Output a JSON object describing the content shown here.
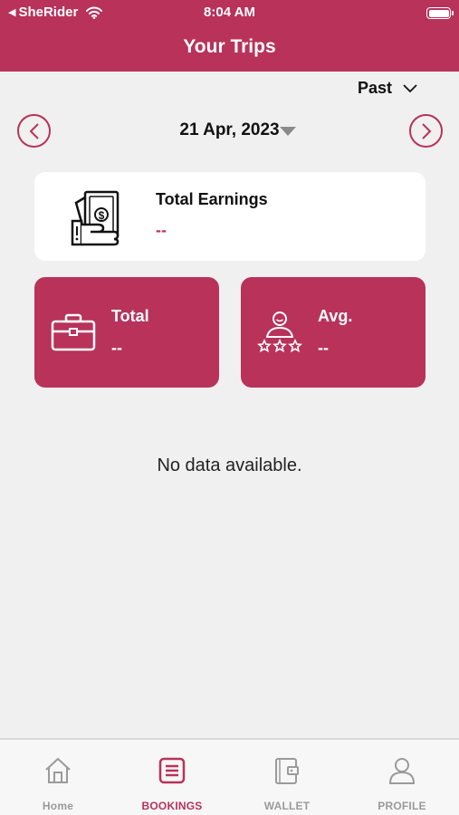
{
  "status_bar": {
    "back_app": "SheRider",
    "time": "8:04 AM"
  },
  "header": {
    "title": "Your Trips"
  },
  "filter": {
    "label": "Past"
  },
  "date_nav": {
    "date": "21 Apr, 2023"
  },
  "earnings": {
    "title": "Total Earnings",
    "value": "--"
  },
  "stats": [
    {
      "label": "Total",
      "value": "--",
      "icon": "briefcase-icon"
    },
    {
      "label": "Avg.",
      "value": "--",
      "icon": "rating-icon"
    }
  ],
  "empty_message": "No data available.",
  "tabs": [
    {
      "label": "Home",
      "icon": "home-icon",
      "active": false
    },
    {
      "label": "BOOKINGS",
      "icon": "bookings-icon",
      "active": true
    },
    {
      "label": "WALLET",
      "icon": "wallet-icon",
      "active": false
    },
    {
      "label": "PROFILE",
      "icon": "profile-icon",
      "active": false
    }
  ],
  "colors": {
    "accent": "#b8325a",
    "background": "#f0f0f0",
    "inactive": "#9a9a9a"
  }
}
